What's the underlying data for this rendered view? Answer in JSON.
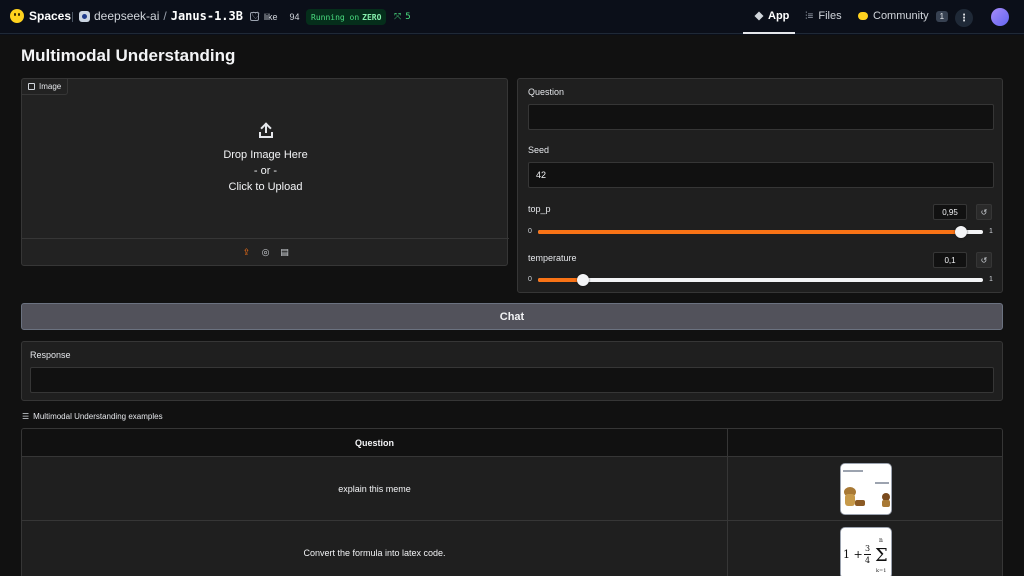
{
  "header": {
    "brand": "Spaces",
    "org": "deepseek-ai",
    "slash": "/",
    "repo": "Janus-1.3B",
    "like_label": "like",
    "like_count": "94",
    "running_prefix": "Running on",
    "running_hw": "ZERO",
    "zero_count": "5",
    "nav": {
      "app": "App",
      "files": "Files",
      "community": "Community",
      "community_badge": "1"
    }
  },
  "main": {
    "title": "Multimodal Understanding",
    "image": {
      "tag": "Image",
      "drop_line1": "Drop Image Here",
      "drop_line2": "- or -",
      "drop_line3": "Click to Upload"
    },
    "question": {
      "label": "Question",
      "value": ""
    },
    "seed": {
      "label": "Seed",
      "value": "42"
    },
    "top_p": {
      "label": "top_p",
      "value": "0,95",
      "min": "0",
      "max": "1",
      "level": 0.95
    },
    "temperature": {
      "label": "temperature",
      "value": "0,1",
      "min": "0",
      "max": "1",
      "level": 0.1
    },
    "chat_button": "Chat",
    "response": {
      "label": "Response",
      "value": ""
    },
    "examples": {
      "label": "Multimodal Understanding examples",
      "header_question": "Question",
      "rows": [
        {
          "question": "explain this meme"
        },
        {
          "question": "Convert the formula into latex code."
        }
      ]
    }
  },
  "colors": {
    "accent": "#f97316",
    "background": "#111111",
    "panel": "#1f1f1f"
  }
}
